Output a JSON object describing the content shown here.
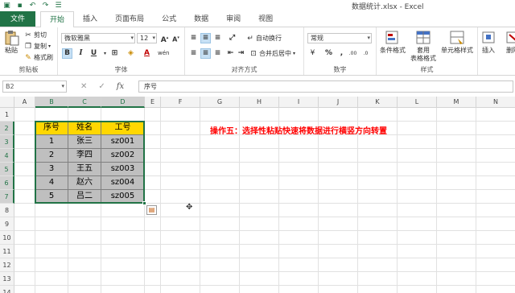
{
  "title_bar": {
    "title": "数据统计.xlsx - Excel",
    "qat": [
      {
        "name": "excel-logo-icon",
        "glyph": "▣"
      },
      {
        "name": "save-icon",
        "glyph": "▪"
      },
      {
        "name": "undo-icon",
        "glyph": "↶"
      },
      {
        "name": "redo-icon",
        "glyph": "↷"
      },
      {
        "name": "customize-qat-icon",
        "glyph": "☰"
      }
    ]
  },
  "tabs": [
    "文件",
    "开始",
    "插入",
    "页面布局",
    "公式",
    "数据",
    "审阅",
    "视图"
  ],
  "active_tab": "开始",
  "ribbon": {
    "clipboard": {
      "label": "剪贴板",
      "paste": "粘贴",
      "cut": "剪切",
      "copy": "复制",
      "format_painter": "格式刷"
    },
    "font": {
      "label": "字体",
      "font_name": "微软雅黑",
      "font_size": "12",
      "bold": "B",
      "italic": "I",
      "underline": "U",
      "grow": "A",
      "shrink": "A",
      "font_color_glyph": "A",
      "wen": "wén"
    },
    "alignment": {
      "label": "对齐方式",
      "wrap": "自动换行",
      "merge": "合并后居中"
    },
    "number": {
      "label": "数字",
      "format": "常规",
      "percent": "%",
      "comma": ",",
      "inc_dec": ".00",
      "dec_dec": ".0"
    },
    "styles": {
      "label": "样式",
      "conditional": "条件格式",
      "table": "套用",
      "table2": "表格格式",
      "cell_styles": "单元格样式"
    },
    "cells": {
      "insert": "插入",
      "delete": "删除"
    }
  },
  "formula_bar": {
    "name_box": "B2",
    "content": "序号",
    "cancel": "✕",
    "enter": "✓",
    "fx": "fx"
  },
  "columns": [
    "A",
    "B",
    "C",
    "D",
    "E",
    "F",
    "G",
    "H",
    "I",
    "J",
    "K",
    "L",
    "M",
    "N"
  ],
  "rows": [
    "1",
    "2",
    "3",
    "4",
    "5",
    "6",
    "7",
    "8",
    "9",
    "10",
    "11",
    "12",
    "13",
    "14"
  ],
  "table": {
    "headers": [
      "序号",
      "姓名",
      "工号"
    ],
    "rows": [
      [
        "1",
        "张三",
        "sz001"
      ],
      [
        "2",
        "李四",
        "sz002"
      ],
      [
        "3",
        "王五",
        "sz003"
      ],
      [
        "4",
        "赵六",
        "sz004"
      ],
      [
        "5",
        "吕二",
        "sz005"
      ]
    ]
  },
  "annotation": "操作五：选择性粘贴快速将数据进行横竖方向转置",
  "colors": {
    "excel_green": "#217346",
    "header_fill": "#ffd700",
    "body_fill": "#bfbfbf",
    "annotation": "#ff0000"
  }
}
